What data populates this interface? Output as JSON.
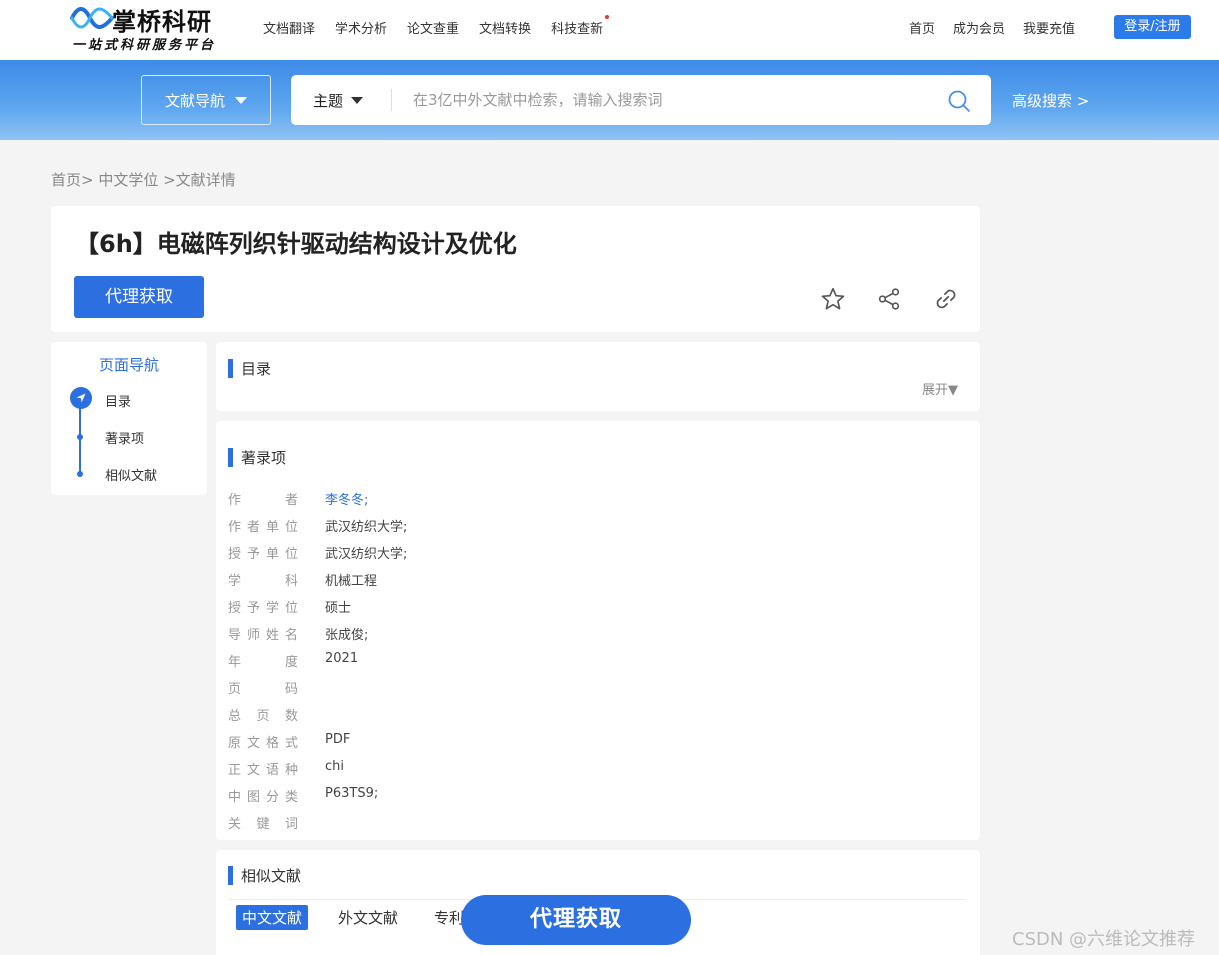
{
  "header": {
    "brand": "掌桥科研",
    "slogan": "一站式科研服务平台",
    "nav": [
      "文档翻译",
      "学术分析",
      "论文查重",
      "文档转换",
      "科技查新"
    ],
    "right_nav": [
      "首页",
      "成为会员",
      "我要充值"
    ],
    "login_label": "登录/注册"
  },
  "search": {
    "nav_label": "文献导航",
    "scope_label": "主题",
    "placeholder": "在3亿中外文献中检索，请输入搜索词",
    "advanced_label": "高级搜索 >"
  },
  "breadcrumb": "首页>  中文学位  >文献详情",
  "document": {
    "title": "【6h】电磁阵列织针驱动结构设计及优化",
    "get_label": "代理获取",
    "icons": [
      "star-icon",
      "share-icon",
      "link-icon"
    ]
  },
  "side_nav": {
    "title": "页面导航",
    "items": [
      "目录",
      "著录项",
      "相似文献"
    ]
  },
  "toc": {
    "heading": "目录",
    "expand_label": "展开▼"
  },
  "metadata": {
    "heading": "著录项",
    "rows": [
      {
        "key": "作者",
        "value": "李冬冬;",
        "link": true
      },
      {
        "key": "作者单位",
        "value": "武汉纺织大学;"
      },
      {
        "key": "授予单位",
        "value": "武汉纺织大学;"
      },
      {
        "key": "学科",
        "value": "机械工程"
      },
      {
        "key": "授予学位",
        "value": "硕士"
      },
      {
        "key": "导师姓名",
        "value": "张成俊;"
      },
      {
        "key": "年度",
        "value": "2021"
      },
      {
        "key": "页码",
        "value": ""
      },
      {
        "key": "总页数",
        "value": ""
      },
      {
        "key": "原文格式",
        "value": "PDF"
      },
      {
        "key": "正文语种",
        "value": "chi"
      },
      {
        "key": "中图分类",
        "value": "P63TS9;"
      },
      {
        "key": "关键词",
        "value": ""
      }
    ]
  },
  "similar": {
    "heading": "相似文献",
    "tabs": [
      "中文文献",
      "外文文献",
      "专利"
    ]
  },
  "float_button": "代理获取",
  "watermark": "CSDN @六维论文推荐",
  "colors": {
    "accent": "#2b6fe0",
    "banner": "#4a95ea"
  }
}
